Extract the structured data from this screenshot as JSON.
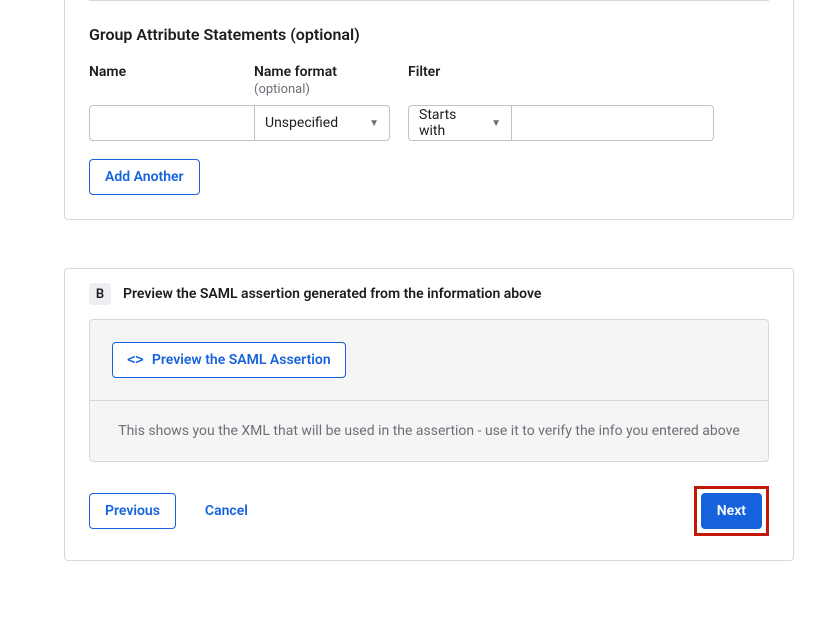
{
  "groupSection": {
    "title": "Group Attribute Statements (optional)",
    "columns": {
      "name": "Name",
      "format": "Name format",
      "formatSub": "(optional)",
      "filter": "Filter"
    },
    "row": {
      "nameValue": "",
      "formatSelected": "Unspecified",
      "filterSelected": "Starts with",
      "filterValue": ""
    },
    "addAnotherLabel": "Add Another"
  },
  "previewSection": {
    "badge": "B",
    "title": "Preview the SAML assertion generated from the information above",
    "previewBtnLabel": "Preview the SAML Assertion",
    "helpText": "This shows you the XML that will be used in the assertion - use it to verify the info you entered above"
  },
  "footer": {
    "previous": "Previous",
    "cancel": "Cancel",
    "next": "Next"
  }
}
